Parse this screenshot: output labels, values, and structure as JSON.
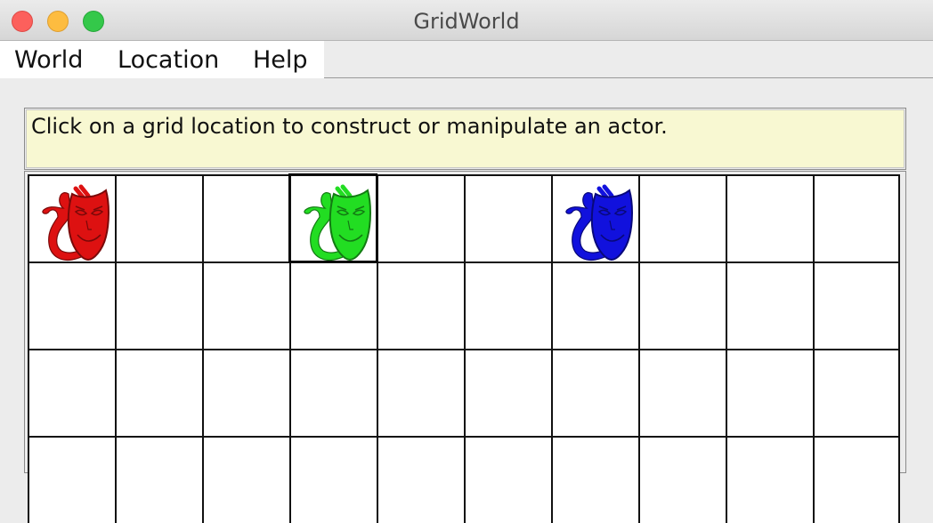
{
  "window": {
    "title": "GridWorld"
  },
  "menu": {
    "items": [
      "World",
      "Location",
      "Help"
    ]
  },
  "message": "Click on a grid location to construct or manipulate an actor.",
  "grid": {
    "rows": 4,
    "cols": 10,
    "selected_cell": [
      0,
      3
    ],
    "actors": [
      {
        "row": 0,
        "col": 0,
        "type": "mask-icon",
        "color": "#dd1111"
      },
      {
        "row": 0,
        "col": 3,
        "type": "mask-icon",
        "color": "#22dd22"
      },
      {
        "row": 0,
        "col": 6,
        "type": "mask-icon",
        "color": "#1111dd"
      }
    ]
  }
}
